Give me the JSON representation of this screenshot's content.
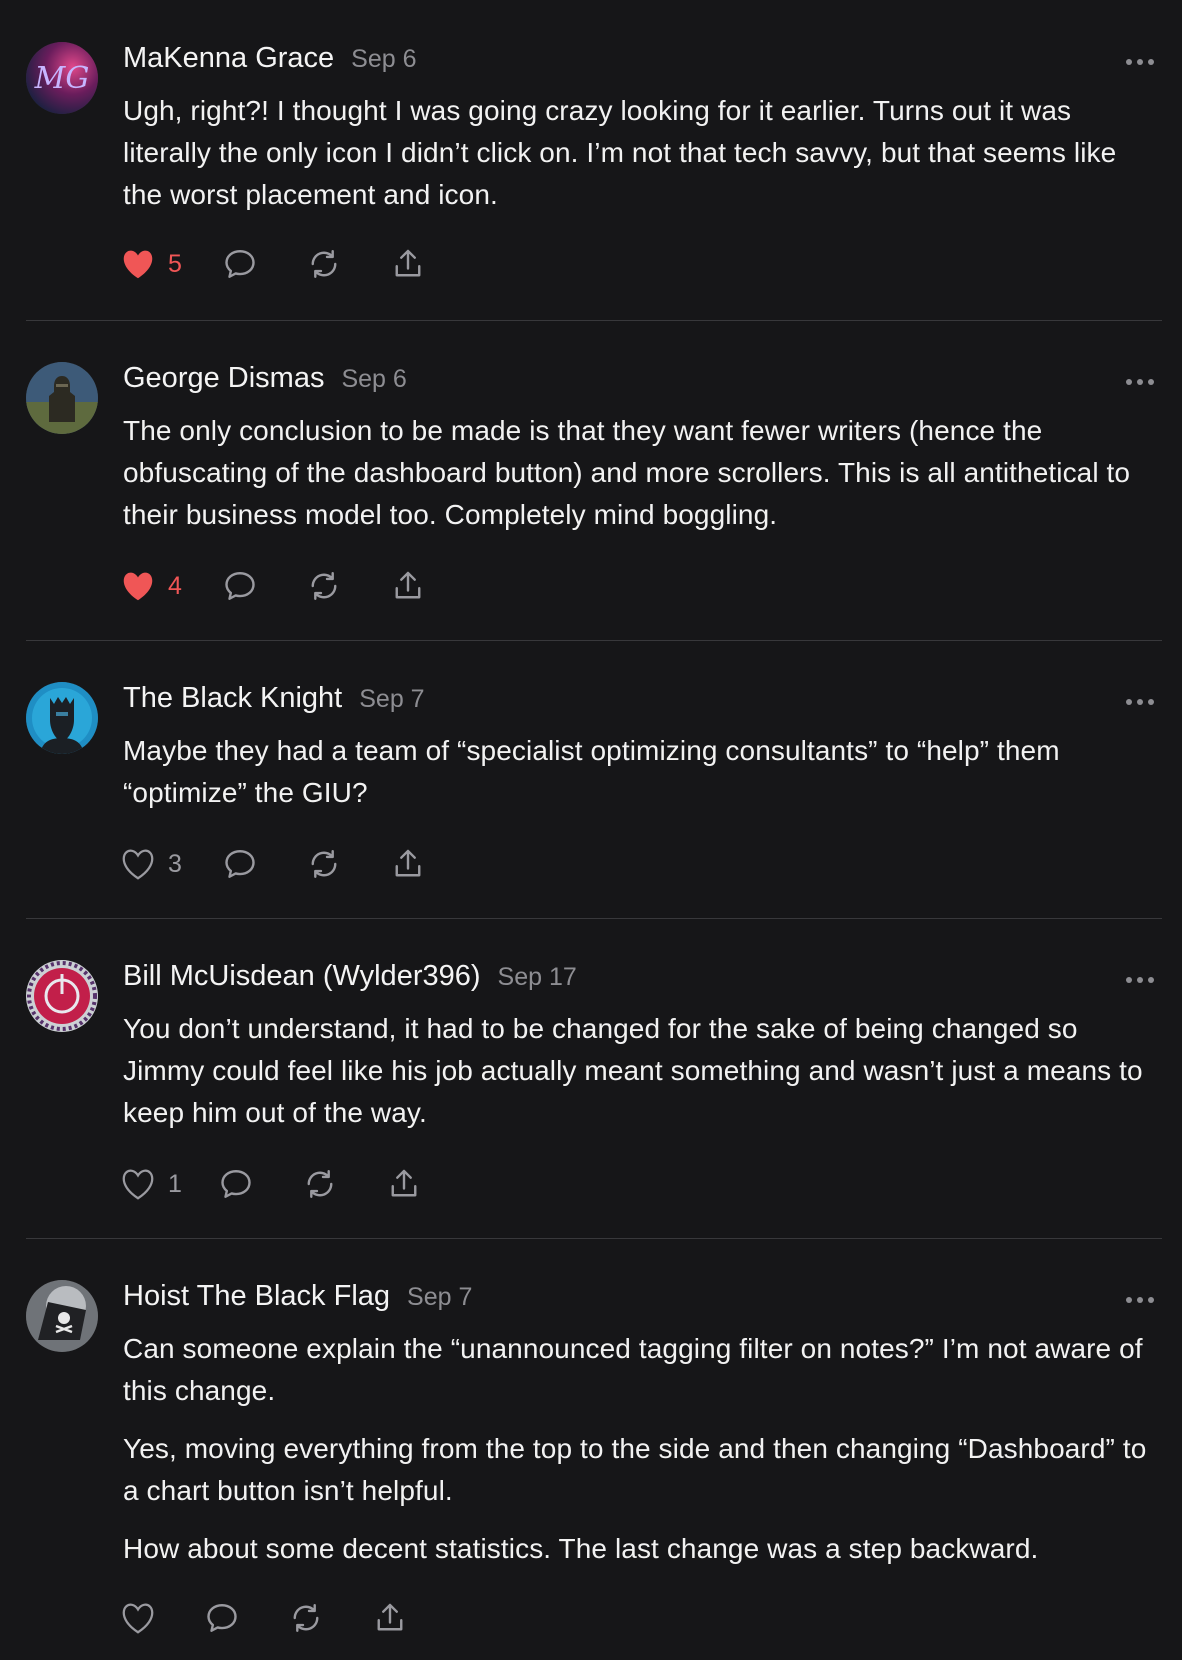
{
  "comments": [
    {
      "author": "MaKenna Grace",
      "date": "Sep 6",
      "paragraphs": [
        "Ugh, right?! I thought I was going crazy looking for it earlier. Turns out it was literally the only icon I didn’t click on. I’m not that tech savvy, but that seems like the worst placement and icon."
      ],
      "likes": "5",
      "liked": true,
      "avatar_initials": "MG"
    },
    {
      "author": "George Dismas",
      "date": "Sep 6",
      "paragraphs": [
        "The only conclusion to be made is that they want fewer writers (hence the obfuscating of the dashboard button) and more scrollers. This is all antithetical to their business model too. Completely mind boggling."
      ],
      "likes": "4",
      "liked": true
    },
    {
      "author": "The Black Knight",
      "date": "Sep 7",
      "paragraphs": [
        "Maybe they had a team of “specialist optimizing consultants” to “help” them “optimize” the GIU?"
      ],
      "likes": "3",
      "liked": false
    },
    {
      "author": "Bill McUisdean (Wylder396)",
      "date": "Sep 17",
      "paragraphs": [
        "You don’t understand, it had to be changed for the sake of being changed so Jimmy could feel like his job actually meant something and wasn’t just a means to keep him out of the way."
      ],
      "likes": "1",
      "liked": false
    },
    {
      "author": "Hoist The Black Flag",
      "date": "Sep 7",
      "paragraphs": [
        "Can someone explain the “unannounced tagging filter on notes?” I’m not aware of this change.",
        "Yes, moving everything from the top to the side and then changing “Dashboard” to a chart button isn’t helpful.",
        "How about some decent statistics. The last change was a step backward."
      ],
      "likes": "",
      "liked": false
    }
  ],
  "colors": {
    "background": "#161618",
    "like_active": "#f05656",
    "icon": "#9a9aa0",
    "divider": "#38383b"
  },
  "icons": [
    "heart-icon",
    "comment-icon",
    "restack-icon",
    "share-icon",
    "more-icon"
  ]
}
